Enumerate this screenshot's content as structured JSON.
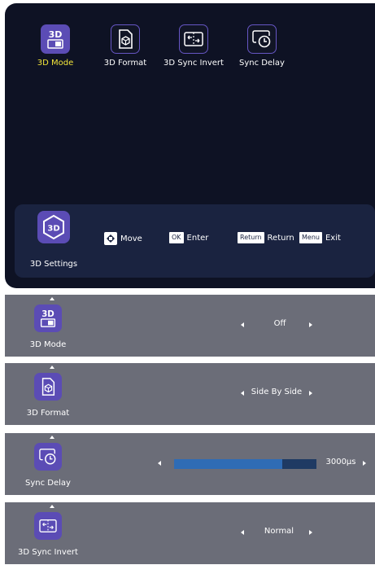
{
  "top_menu": {
    "items": [
      {
        "label": "3D Mode",
        "icon": "3d-mode-icon",
        "active": true
      },
      {
        "label": "3D Format",
        "icon": "3d-format-icon",
        "active": false
      },
      {
        "label": "3D Sync Invert",
        "icon": "sync-invert-icon",
        "active": false
      },
      {
        "label": "Sync Delay",
        "icon": "sync-delay-icon",
        "active": false
      }
    ]
  },
  "help_bar": {
    "settings_label": "3D Settings",
    "settings_icon_text": "3D",
    "move_label": "Move",
    "ok_key": "OK",
    "enter_label": "Enter",
    "return_key": "Return",
    "return_label": "Return",
    "menu_key": "Menu",
    "exit_label": "Exit"
  },
  "rows": {
    "mode": {
      "label": "3D Mode",
      "icon_text": "3D",
      "value": "Off"
    },
    "format": {
      "label": "3D Format",
      "value": "Side By Side"
    },
    "delay": {
      "label": "Sync Delay",
      "value": "3000μs",
      "fill_fraction": 0.76
    },
    "invert": {
      "label": "3D Sync Invert",
      "value": "Normal"
    }
  },
  "colors": {
    "accent_purple": "#5b4cb5",
    "active_label": "#f2e53a",
    "panel_bg": "#0e1224",
    "row_bg": "#6b6d78",
    "slider_fill": "#2f6cb5"
  }
}
